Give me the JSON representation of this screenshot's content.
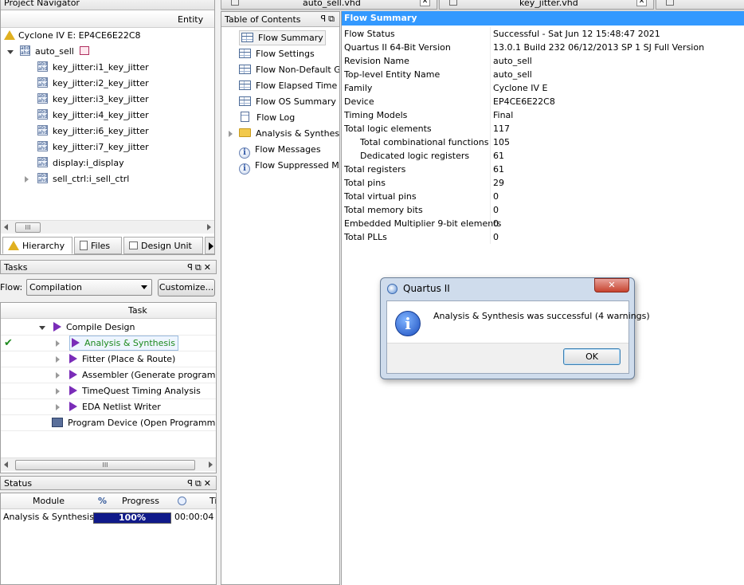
{
  "project_navigator": {
    "title": "Project Navigator",
    "column": "Entity",
    "device": "Cyclone IV E: EP4CE6E22C8",
    "root": "auto_sell",
    "children": [
      "key_jitter:i1_key_jitter",
      "key_jitter:i2_key_jitter",
      "key_jitter:i3_key_jitter",
      "key_jitter:i4_key_jitter",
      "key_jitter:i6_key_jitter",
      "key_jitter:i7_key_jitter",
      "display:i_display",
      "sell_ctrl:i_sell_ctrl"
    ],
    "tabs": [
      "Hierarchy",
      "Files",
      "Design Unit"
    ]
  },
  "tasks": {
    "title": "Tasks",
    "flow_label": "Flow:",
    "flow_value": "Compilation",
    "customize": "Customize...",
    "column": "Task",
    "items": [
      "Compile Design",
      "Analysis & Synthesis",
      "Fitter (Place & Route)",
      "Assembler (Generate programming",
      "TimeQuest Timing Analysis",
      "EDA Netlist Writer",
      "Program Device (Open Programmer)"
    ]
  },
  "status": {
    "title": "Status",
    "columns": [
      "Module",
      "%",
      "Progress",
      "Ti"
    ],
    "module": "Analysis & Synthesis",
    "progress_text": "100%",
    "progress_fraction": 1.0,
    "time": "00:00:04"
  },
  "tabs_top": [
    "auto_sell.vhd",
    "key_jitter.vhd"
  ],
  "toc": {
    "title": "Table of Contents",
    "items": [
      "Flow Summary",
      "Flow Settings",
      "Flow Non-Default Glo",
      "Flow Elapsed Time",
      "Flow OS Summary",
      "Flow Log",
      "Analysis & Synthesis",
      "Flow Messages",
      "Flow Suppressed Mes"
    ]
  },
  "flow_summary": {
    "title": "Flow Summary",
    "rows": [
      [
        "Flow Status",
        "Successful - Sat Jun 12 15:48:47 2021"
      ],
      [
        "Quartus II 64-Bit Version",
        "13.0.1 Build 232 06/12/2013 SP 1 SJ Full Version"
      ],
      [
        "Revision Name",
        "auto_sell"
      ],
      [
        "Top-level Entity Name",
        "auto_sell"
      ],
      [
        "Family",
        "Cyclone IV E"
      ],
      [
        "Device",
        "EP4CE6E22C8"
      ],
      [
        "Timing Models",
        "Final"
      ],
      [
        "Total logic elements",
        "117"
      ],
      [
        "Total combinational functions",
        "105"
      ],
      [
        "Dedicated logic registers",
        "61"
      ],
      [
        "Total registers",
        "61"
      ],
      [
        "Total pins",
        "29"
      ],
      [
        "Total virtual pins",
        "0"
      ],
      [
        "Total memory bits",
        "0"
      ],
      [
        "Embedded Multiplier 9-bit elements",
        "0"
      ],
      [
        "Total PLLs",
        "0"
      ]
    ]
  },
  "dialog": {
    "title": "Quartus II",
    "message": "Analysis & Synthesis was successful (4 warnings)",
    "ok": "OK"
  },
  "colors": {
    "selection_blue": "#3399ff",
    "progress_fill": "#101a8a",
    "success_green": "#1e8a1e"
  }
}
